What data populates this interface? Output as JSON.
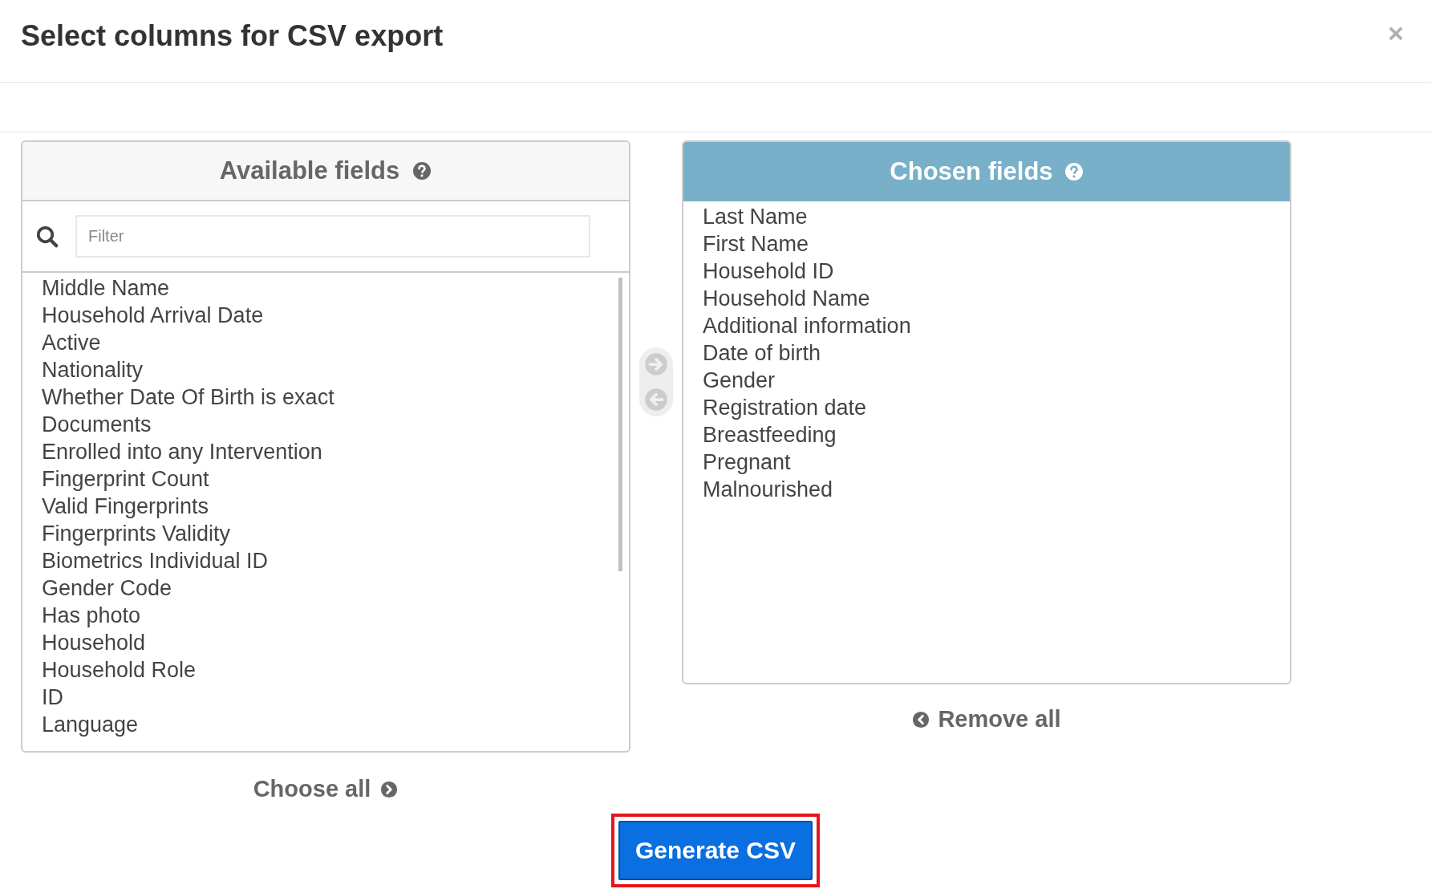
{
  "dialog": {
    "title": "Select columns for CSV export",
    "close": "×"
  },
  "available": {
    "title": "Available fields",
    "filter": {
      "placeholder": "Filter"
    },
    "items": [
      "Middle Name",
      "Household Arrival Date",
      "Active",
      "Nationality",
      "Whether Date Of Birth is exact",
      "Documents",
      "Enrolled into any Intervention",
      "Fingerprint Count",
      "Valid Fingerprints",
      "Fingerprints Validity",
      "Biometrics Individual ID",
      "Gender Code",
      "Has photo",
      "Household",
      "Household Role",
      "ID",
      "Language"
    ],
    "action": "Choose all"
  },
  "chosen": {
    "title": "Chosen fields",
    "items": [
      "Last Name",
      "First Name",
      "Household ID",
      "Household Name",
      "Additional information",
      "Date of birth",
      "Gender",
      "Registration date",
      "Breastfeeding",
      "Pregnant",
      "Malnourished"
    ],
    "action": "Remove all"
  },
  "generate_button": "Generate CSV"
}
